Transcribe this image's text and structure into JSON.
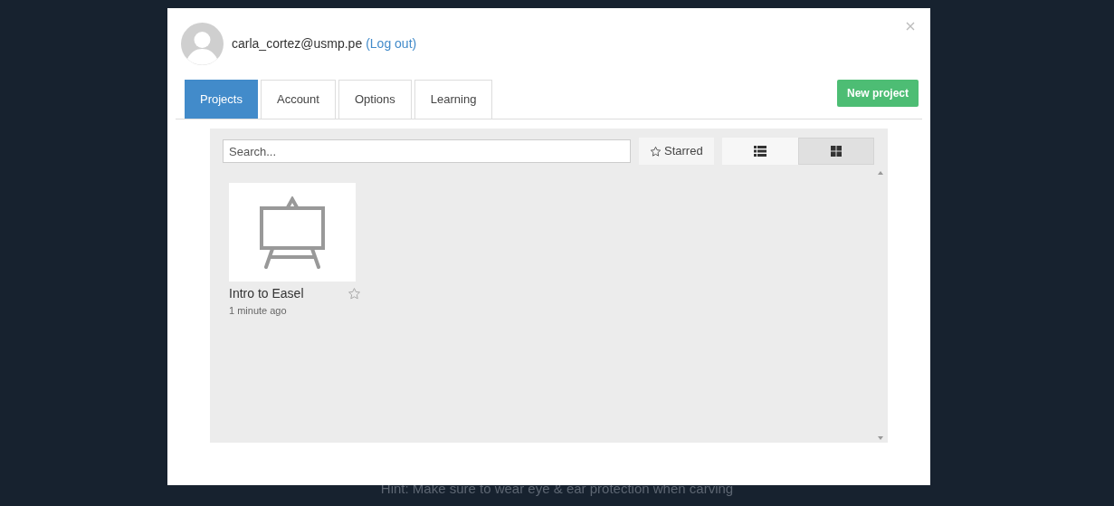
{
  "user": {
    "email": "carla_cortez@usmp.pe",
    "logout": "(Log out)"
  },
  "tabs": [
    {
      "label": "Projects",
      "selected": true
    },
    {
      "label": "Account",
      "selected": false
    },
    {
      "label": "Options",
      "selected": false
    },
    {
      "label": "Learning",
      "selected": false
    }
  ],
  "new_project": "New project",
  "search": {
    "placeholder": "Search..."
  },
  "starred_filter": {
    "label": "Starred"
  },
  "views": [
    {
      "kind": "list",
      "selected": false
    },
    {
      "kind": "grid",
      "selected": true
    }
  ],
  "projects": [
    {
      "name": "Intro to Easel",
      "time": "1 minute ago",
      "starred": false
    }
  ],
  "hint": "Hint: Make sure to wear eye & ear protection when carving"
}
